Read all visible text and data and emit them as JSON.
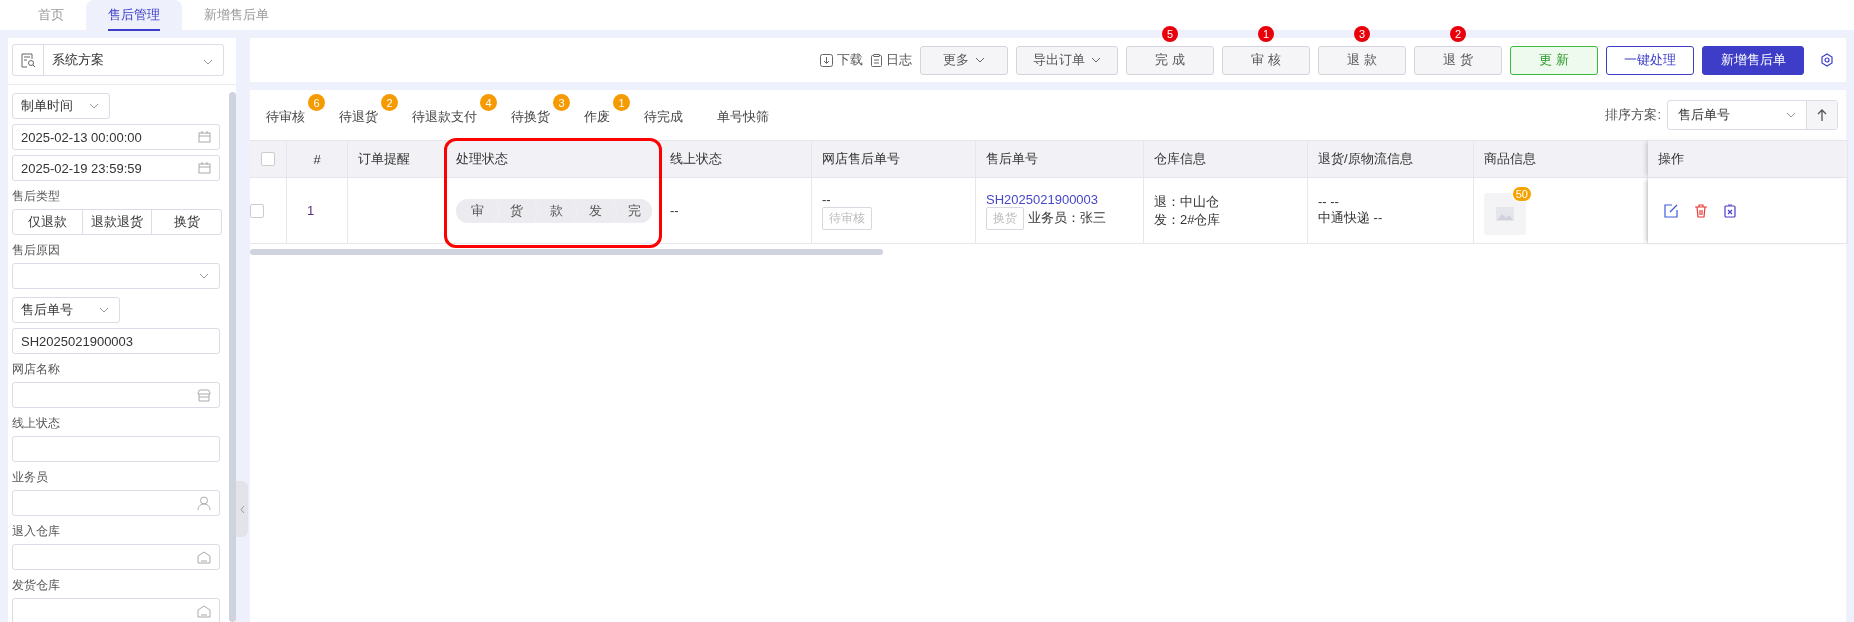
{
  "tabs": [
    {
      "label": "首页",
      "selected": false
    },
    {
      "label": "售后管理",
      "selected": true
    },
    {
      "label": "新增售后单",
      "selected": false
    }
  ],
  "sidebar": {
    "scheme": "系统方案",
    "date_type": "制单时间",
    "date_start": "2025-02-13 00:00:00",
    "date_end": "2025-02-19 23:59:59",
    "type_label": "售后类型",
    "types": [
      {
        "label": "仅退款",
        "selected": false
      },
      {
        "label": "退款退货",
        "selected": false
      },
      {
        "label": "换货",
        "selected": false
      }
    ],
    "reason_label": "售后原因",
    "number_type": "售后单号",
    "number_value": "SH2025021900003",
    "fields": [
      {
        "label": "网店名称",
        "kind": "shop"
      },
      {
        "label": "线上状态",
        "kind": "plain"
      },
      {
        "label": "业务员",
        "kind": "person"
      },
      {
        "label": "退入仓库",
        "kind": "warehouse"
      },
      {
        "label": "发货仓库",
        "kind": "warehouse"
      }
    ]
  },
  "toolbar": {
    "links": [
      {
        "label": "下载",
        "kind": "download"
      },
      {
        "label": "日志",
        "kind": "log"
      }
    ],
    "dropdowns": [
      "更多",
      "导出订单"
    ],
    "actions": [
      {
        "label": "完 成",
        "badge": "5"
      },
      {
        "label": "审 核",
        "badge": "1"
      },
      {
        "label": "退 款",
        "badge": "3"
      },
      {
        "label": "退 货",
        "badge": "2"
      }
    ],
    "buttons": [
      {
        "label": "更 新",
        "kind": "success"
      },
      {
        "label": "一键处理",
        "kind": "outline"
      },
      {
        "label": "新增售后单",
        "kind": "primary"
      }
    ]
  },
  "filters": [
    {
      "label": "待审核",
      "badge": "6"
    },
    {
      "label": "待退货",
      "badge": "2"
    },
    {
      "label": "待退款支付",
      "badge": "4"
    },
    {
      "label": "待换货",
      "badge": "3"
    },
    {
      "label": "作废",
      "badge": "1"
    },
    {
      "label": "待完成"
    },
    {
      "label": "单号快筛"
    }
  ],
  "sort": {
    "label": "排序方案:",
    "value": "售后单号"
  },
  "table": {
    "all_checked": false,
    "columns": [
      "#",
      "订单提醒",
      "处理状态",
      "线上状态",
      "网店售后单号",
      "售后单号",
      "仓库信息",
      "退货/原物流信息",
      "商品信息",
      "操作"
    ],
    "rows": [
      {
        "checked": false,
        "index": "1",
        "steps": [
          "审",
          "货",
          "款",
          "发",
          "完"
        ],
        "online_status": "--",
        "shop_number": "--",
        "shop_tag": "待审核",
        "order_number": "SH2025021900003",
        "type_tag": "换货",
        "salesperson": "业务员：张三",
        "warehouse": [
          "退：中山仓",
          "发：2#仓库"
        ],
        "logistics": [
          "-- --",
          "中通快递 --"
        ],
        "goods_count": "50"
      }
    ]
  }
}
